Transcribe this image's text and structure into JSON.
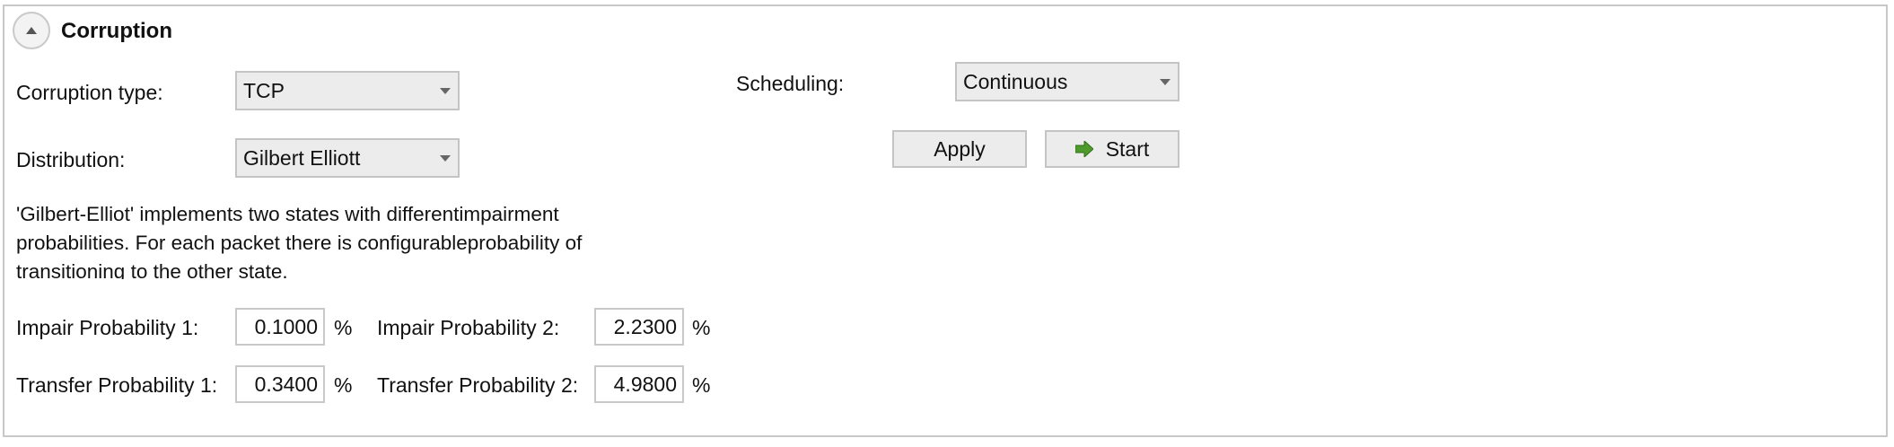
{
  "section": {
    "title": "Corruption"
  },
  "corruption_type": {
    "label": "Corruption type:",
    "value": "TCP"
  },
  "distribution": {
    "label": "Distribution:",
    "value": "Gilbert Elliott"
  },
  "scheduling": {
    "label": "Scheduling:",
    "value": "Continuous"
  },
  "buttons": {
    "apply": "Apply",
    "start": "Start"
  },
  "description": {
    "line1": "'Gilbert-Elliot' implements two states with differentimpairment",
    "line2": "probabilities. For each packet there is configurableprobability of",
    "line3": "transitioning to the other state."
  },
  "probabilities": {
    "unit": "%",
    "impair1": {
      "label": "Impair Probability 1:",
      "value": "0.1000"
    },
    "impair2": {
      "label": "Impair Probability 2:",
      "value": "2.2300"
    },
    "transfer1": {
      "label": "Transfer Probability 1:",
      "value": "0.3400"
    },
    "transfer2": {
      "label": "Transfer Probability 2:",
      "value": "4.9800"
    }
  },
  "icons": {
    "collapse": "chevron-up-icon",
    "start": "arrow-right-icon"
  },
  "colors": {
    "start_arrow": "#4f9a2d",
    "panel_border": "#c8c8c8",
    "control_background": "#ececec"
  }
}
